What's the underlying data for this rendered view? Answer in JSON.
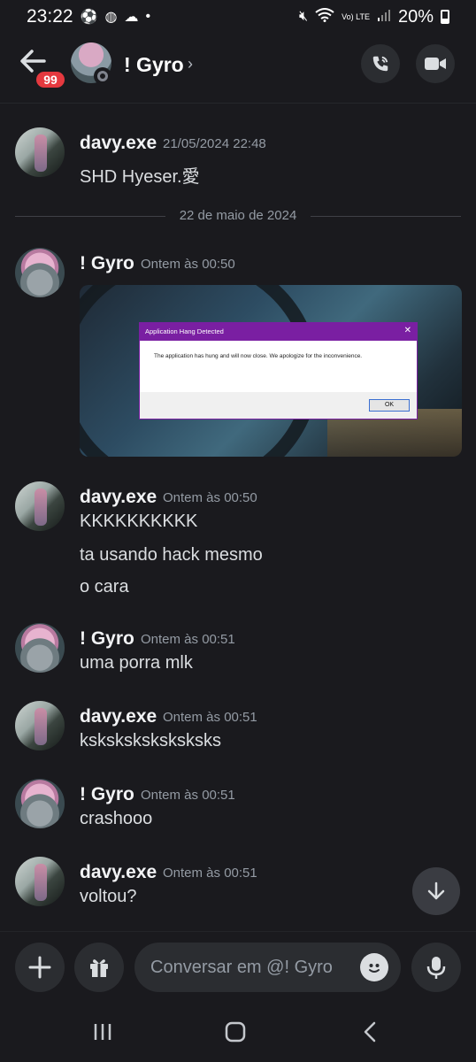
{
  "status_bar": {
    "time": "23:22",
    "battery": "20%",
    "network": "Vo) LTE"
  },
  "header": {
    "unread_count": "99",
    "title": "! Gyro",
    "chevron": "›"
  },
  "day_separator": "22 de maio de 2024",
  "messages": [
    {
      "author": "davy.exe",
      "timestamp": "21/05/2024 22:48",
      "lines": [
        "SHD Hyeser.愛"
      ]
    },
    {
      "author": "! Gyro",
      "timestamp": "Ontem às 00:50",
      "attachment": {
        "dialog_title": "Application Hang Detected",
        "dialog_text": "The application has hung and will now close. We apologize for the inconvenience.",
        "ok_label": "OK",
        "close_glyph": "✕"
      }
    },
    {
      "author": "davy.exe",
      "timestamp": "Ontem às 00:50",
      "lines": [
        "KKKKKKKKKK",
        "ta usando hack mesmo",
        "o cara"
      ]
    },
    {
      "author": "! Gyro",
      "timestamp": "Ontem às 00:51",
      "lines": [
        "uma porra mlk"
      ]
    },
    {
      "author": "davy.exe",
      "timestamp": "Ontem às 00:51",
      "lines": [
        "ksksksksksksksks"
      ]
    },
    {
      "author": "! Gyro",
      "timestamp": "Ontem às 00:51",
      "lines": [
        "crashooo"
      ]
    },
    {
      "author": "davy.exe",
      "timestamp": "Ontem às 00:51",
      "lines": [
        "voltou?"
      ]
    }
  ],
  "composer": {
    "placeholder": "Conversar em @! Gyro",
    "value": ""
  },
  "icons": {
    "back": "arrow-left-icon",
    "call": "phone-icon",
    "video": "video-camera-icon",
    "scroll_down": "arrow-down-icon",
    "plus": "plus-icon",
    "gift": "gift-icon",
    "emoji": "emoji-icon",
    "mic": "microphone-icon"
  },
  "colors": {
    "background": "#1a1a1e",
    "badge": "#e5393f",
    "dialog_accent": "#7a1fa2",
    "muted_text": "#949ba4"
  }
}
